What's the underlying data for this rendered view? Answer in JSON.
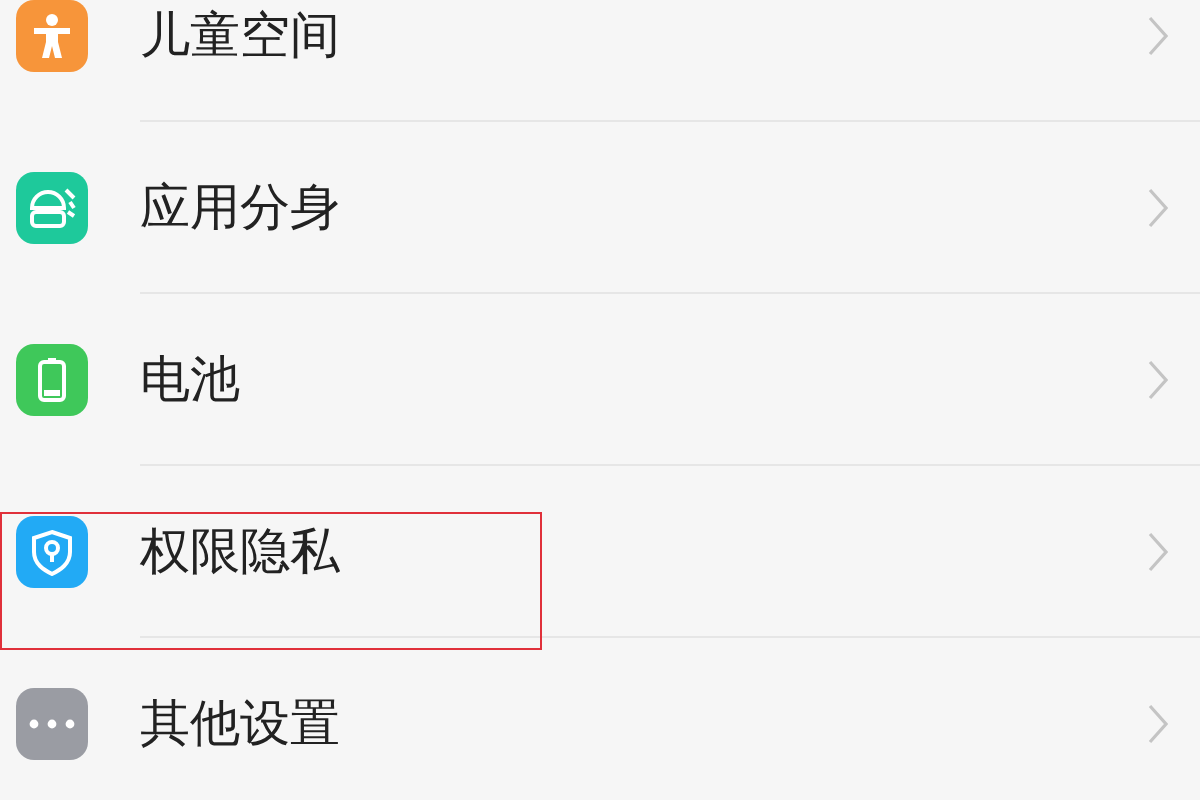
{
  "settings_items": [
    {
      "label": "儿童空间",
      "color": "#f7953a",
      "highlighted": false
    },
    {
      "label": "应用分身",
      "color": "#1ec99b",
      "highlighted": false
    },
    {
      "label": "电池",
      "color": "#3fc85a",
      "highlighted": false
    },
    {
      "label": "权限隐私",
      "color": "#22aaf5",
      "highlighted": true
    },
    {
      "label": "其他设置",
      "color": "#9a9ca3",
      "highlighted": false
    }
  ]
}
